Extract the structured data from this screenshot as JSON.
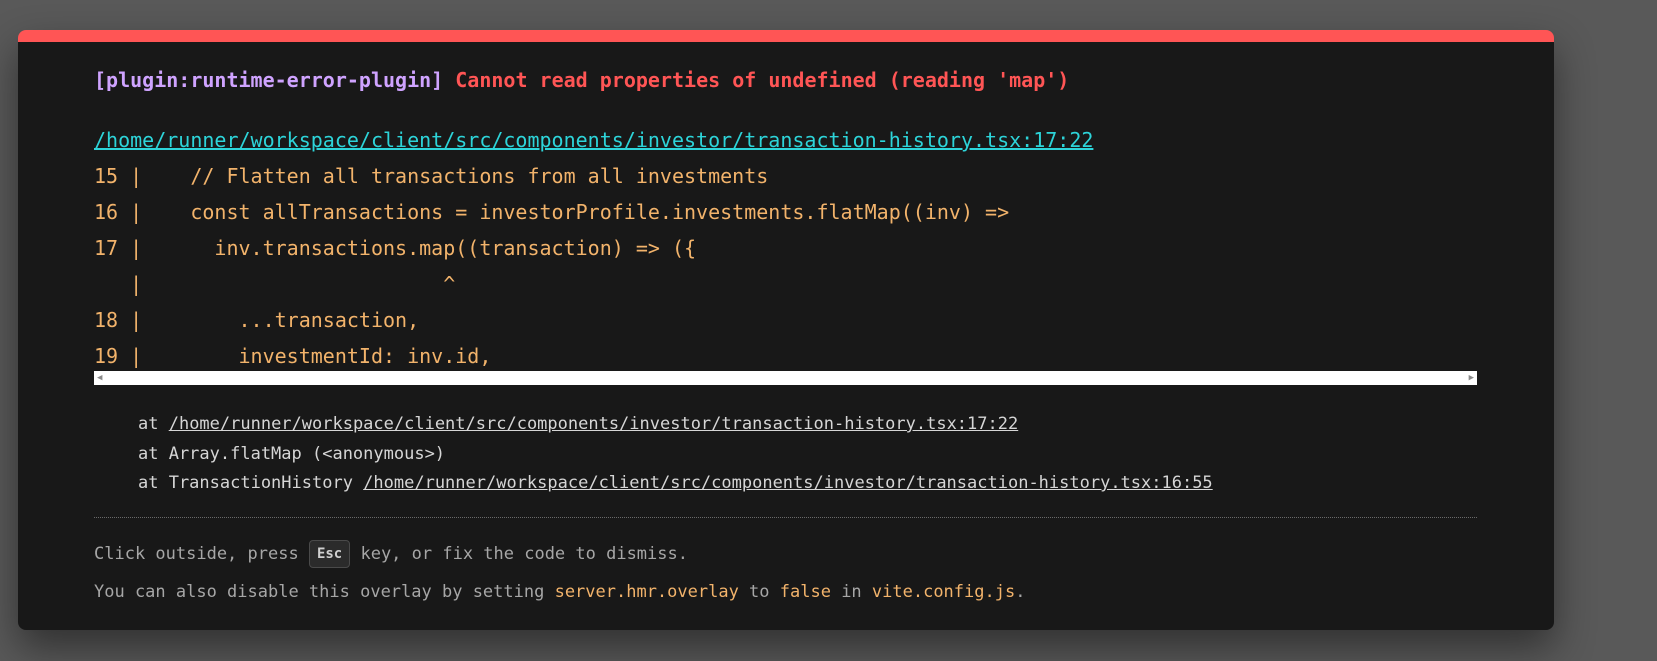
{
  "error": {
    "plugin": "[plugin:runtime-error-plugin]",
    "message": "Cannot read properties of undefined (reading 'map')"
  },
  "file_link": "/home/runner/workspace/client/src/components/investor/transaction-history.tsx:17:22",
  "code_frame": [
    "15 |    // Flatten all transactions from all investments",
    "16 |    const allTransactions = investorProfile.investments.flatMap((inv) =>",
    "17 |      inv.transactions.map((transaction) => ({",
    "   |                         ^",
    "18 |        ...transaction,",
    "19 |        investmentId: inv.id,"
  ],
  "stack": [
    {
      "prefix": "at ",
      "link": "/home/runner/workspace/client/src/components/investor/transaction-history.tsx:17:22"
    },
    {
      "prefix": "at Array.flatMap (<anonymous>)",
      "link": ""
    },
    {
      "prefix": "at TransactionHistory ",
      "link": "/home/runner/workspace/client/src/components/investor/transaction-history.tsx:16:55"
    }
  ],
  "tip": {
    "line1_before": "Click outside, press ",
    "key": "Esc",
    "line1_after": " key, or fix the code to dismiss.",
    "line2_a": "You can also disable this overlay by setting ",
    "line2_code1": "server.hmr.overlay",
    "line2_b": " to ",
    "line2_code2": "false",
    "line2_c": " in ",
    "line2_code3": "vite.config.js",
    "line2_d": "."
  },
  "scrollbar": {
    "left_arrow_icon": "triangle-left",
    "right_arrow_icon": "triangle-right"
  },
  "colors": {
    "accent_bar": "#ff5555",
    "plugin": "#cfa3ff",
    "error": "#ff5555",
    "link": "#2dd4d9",
    "code": "#f2b36b"
  }
}
